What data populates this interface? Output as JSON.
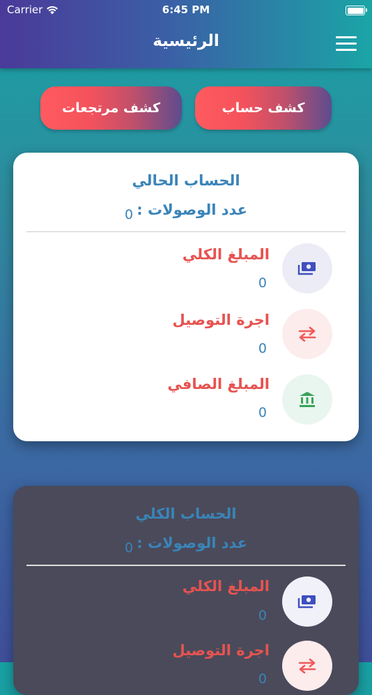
{
  "status": {
    "carrier": "Carrier",
    "time": "6:45 PM"
  },
  "header": {
    "title": "الرئيسية"
  },
  "buttons": {
    "account_statement": "كشف حساب",
    "returns_statement": "كشف مرتجعات"
  },
  "current_account": {
    "title": "الحساب الحالي",
    "receipts_label": "عدد الوصولات :",
    "receipts_count": "0",
    "rows": [
      {
        "label": "المبلغ الكلي",
        "value": "0",
        "icon": "money-icon"
      },
      {
        "label": "اجرة التوصيل",
        "value": "0",
        "icon": "transfer-icon"
      },
      {
        "label": "المبلغ الصافي",
        "value": "0",
        "icon": "bank-icon"
      }
    ]
  },
  "total_account": {
    "title": "الحساب الكلي",
    "receipts_label": "عدد الوصولات :",
    "receipts_count": "0",
    "rows": [
      {
        "label": "المبلغ الكلي",
        "value": "0",
        "icon": "money-icon"
      },
      {
        "label": "اجرة التوصيل",
        "value": "0",
        "icon": "transfer-icon"
      }
    ]
  },
  "colors": {
    "accent_red": "#e65350",
    "accent_blue": "#3a84b8",
    "money_icon": "#3f4fbf",
    "transfer_icon": "#f05a5a",
    "bank_icon": "#3aa35a"
  }
}
